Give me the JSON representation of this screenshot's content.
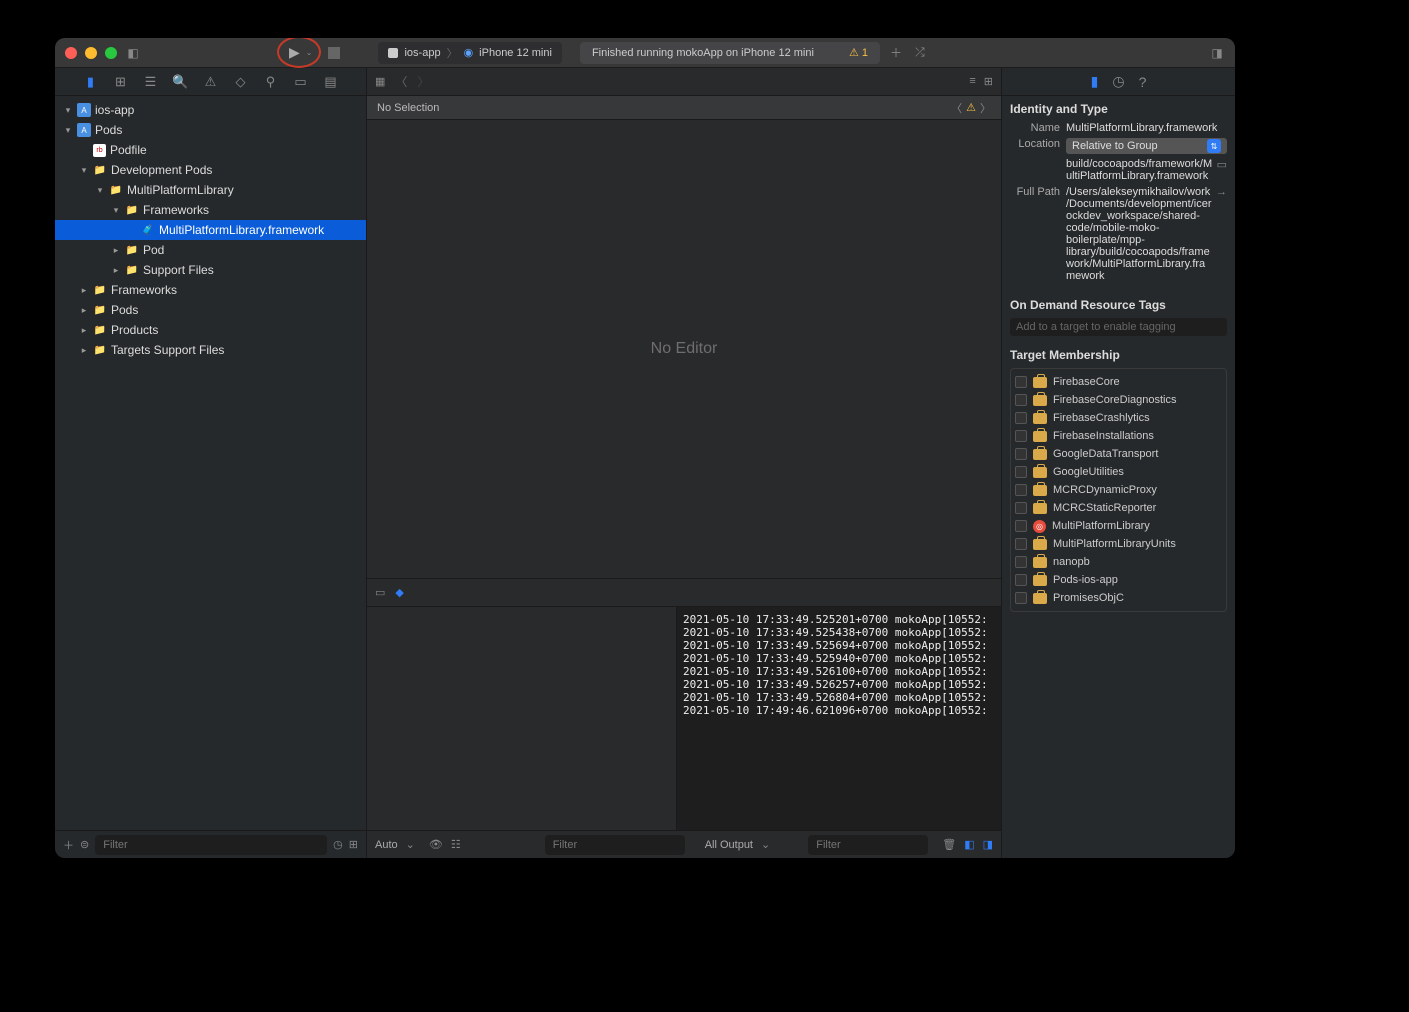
{
  "titlebar": {
    "scheme_app": "ios-app",
    "scheme_device": "iPhone 12 mini",
    "status_text": "Finished running mokoApp on iPhone 12 mini",
    "warning_count": "1"
  },
  "navigator": {
    "filter_placeholder": "Filter",
    "tree": [
      {
        "depth": 0,
        "disc": "▾",
        "icon": "proj",
        "label": "ios-app"
      },
      {
        "depth": 0,
        "disc": "▾",
        "icon": "proj",
        "label": "Pods"
      },
      {
        "depth": 1,
        "disc": "",
        "icon": "rb",
        "label": "Podfile"
      },
      {
        "depth": 1,
        "disc": "▾",
        "icon": "folder",
        "label": "Development Pods"
      },
      {
        "depth": 2,
        "disc": "▾",
        "icon": "folder",
        "label": "MultiPlatformLibrary"
      },
      {
        "depth": 3,
        "disc": "▾",
        "icon": "folder",
        "label": "Frameworks"
      },
      {
        "depth": 4,
        "disc": "",
        "icon": "fw",
        "label": "MultiPlatformLibrary.framework",
        "selected": true
      },
      {
        "depth": 3,
        "disc": "▸",
        "icon": "folder",
        "label": "Pod"
      },
      {
        "depth": 3,
        "disc": "▸",
        "icon": "folder",
        "label": "Support Files"
      },
      {
        "depth": 1,
        "disc": "▸",
        "icon": "folder",
        "label": "Frameworks"
      },
      {
        "depth": 1,
        "disc": "▸",
        "icon": "folder",
        "label": "Pods"
      },
      {
        "depth": 1,
        "disc": "▸",
        "icon": "folder",
        "label": "Products"
      },
      {
        "depth": 1,
        "disc": "▸",
        "icon": "folder",
        "label": "Targets Support Files"
      }
    ]
  },
  "editor": {
    "breadcrumb": "No Selection",
    "placeholder": "No Editor",
    "console_lines": [
      "2021-05-10 17:33:49.525201+0700 mokoApp[10552:",
      "2021-05-10 17:33:49.525438+0700 mokoApp[10552:",
      "2021-05-10 17:33:49.525694+0700 mokoApp[10552:",
      "2021-05-10 17:33:49.525940+0700 mokoApp[10552:",
      "2021-05-10 17:33:49.526100+0700 mokoApp[10552:",
      "2021-05-10 17:33:49.526257+0700 mokoApp[10552:",
      "2021-05-10 17:33:49.526804+0700 mokoApp[10552:",
      "2021-05-10 17:49:46.621096+0700 mokoApp[10552:"
    ],
    "footer": {
      "auto": "Auto",
      "filter_placeholder": "Filter",
      "all_output": "All Output",
      "filter2_placeholder": "Filter"
    }
  },
  "inspector": {
    "identity_heading": "Identity and Type",
    "name_label": "Name",
    "name_value": "MultiPlatformLibrary.framework",
    "location_label": "Location",
    "location_select": "Relative to Group",
    "location_path": "build/cocoapods/framework/MultiPlatformLibrary.framework",
    "fullpath_label": "Full Path",
    "fullpath_value": "/Users/alekseymikhailov/work/Documents/development/icerockdev_workspace/shared-code/mobile-moko-boilerplate/mpp-library/build/cocoapods/framework/MultiPlatformLibrary.framework",
    "ondemand_heading": "On Demand Resource Tags",
    "ondemand_placeholder": "Add to a target to enable tagging",
    "membership_heading": "Target Membership",
    "targets": [
      {
        "name": "FirebaseCore",
        "icon": "suitcase"
      },
      {
        "name": "FirebaseCoreDiagnostics",
        "icon": "suitcase"
      },
      {
        "name": "FirebaseCrashlytics",
        "icon": "suitcase"
      },
      {
        "name": "FirebaseInstallations",
        "icon": "suitcase"
      },
      {
        "name": "GoogleDataTransport",
        "icon": "suitcase"
      },
      {
        "name": "GoogleUtilities",
        "icon": "suitcase"
      },
      {
        "name": "MCRCDynamicProxy",
        "icon": "suitcase"
      },
      {
        "name": "MCRCStaticReporter",
        "icon": "suitcase"
      },
      {
        "name": "MultiPlatformLibrary",
        "icon": "special"
      },
      {
        "name": "MultiPlatformLibraryUnits",
        "icon": "suitcase"
      },
      {
        "name": "nanopb",
        "icon": "suitcase"
      },
      {
        "name": "Pods-ios-app",
        "icon": "suitcase"
      },
      {
        "name": "PromisesObjC",
        "icon": "suitcase"
      }
    ]
  }
}
